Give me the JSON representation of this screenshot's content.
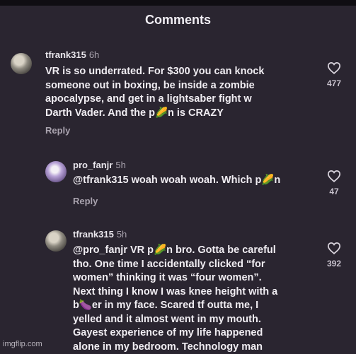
{
  "header": {
    "title": "Comments"
  },
  "comments": [
    {
      "username": "tfrank315",
      "time": "6h",
      "text": "VR is so underrated. For $300 you can knock\nsomeone out in boxing, be inside a zombie\napocalypse, and get in a lightsaber fight w\nDarth Vader. And the p🌽n is CRAZY",
      "reply_label": "Reply",
      "likes": "477",
      "like_icon": "heart-outline-icon"
    },
    {
      "username": "pro_fanjr",
      "time": "5h",
      "text": "@tfrank315 woah woah woah. Which p🌽n",
      "reply_label": "Reply",
      "likes": "47",
      "like_icon": "heart-outline-icon"
    },
    {
      "username": "tfrank315",
      "time": "5h",
      "text": "@pro_fanjr VR p🌽n bro. Gotta be careful\ntho. One time I accidentally clicked “for\nwomen” thinking it was “four women”.\nNext thing I know I was knee height with a\nb🍆er in my face. Scared tf outta me, I\nyelled and it almost went in my mouth.\nGayest experience of my life happened\nalone in my bedroom. Technology man",
      "likes": "392",
      "like_icon": "heart-outline-icon"
    }
  ],
  "watermark": "imgflip.com"
}
